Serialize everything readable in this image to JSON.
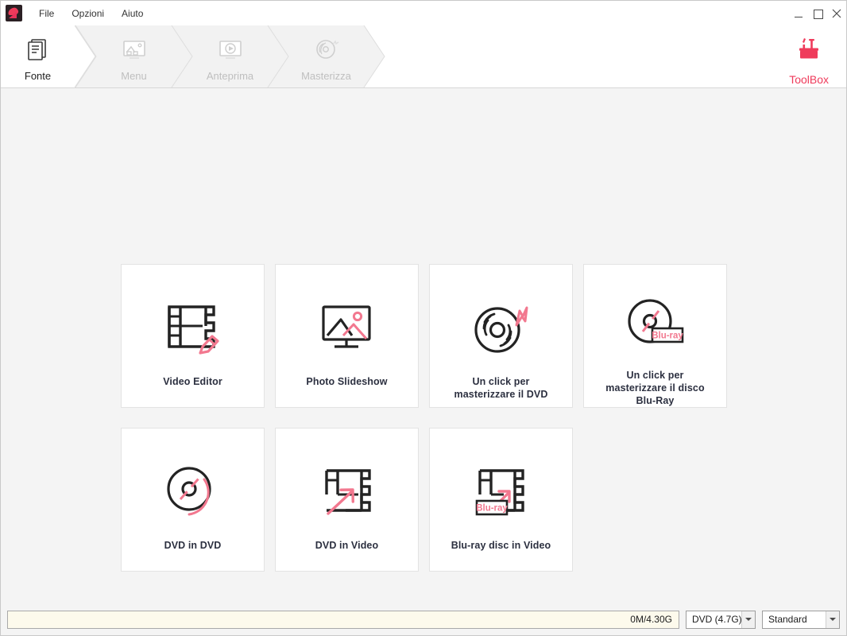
{
  "window": {
    "logo_icon": "app-logo",
    "controls": [
      {
        "name": "minimize",
        "glyph": "minimize-icon"
      },
      {
        "name": "maximize",
        "glyph": "maximize-icon"
      },
      {
        "name": "close",
        "glyph": "close-icon"
      }
    ]
  },
  "menubar": {
    "items": [
      {
        "label": "File"
      },
      {
        "label": "Opzioni"
      },
      {
        "label": "Aiuto"
      }
    ]
  },
  "nav": {
    "steps": [
      {
        "label": "Fonte",
        "icon": "document-stack-icon",
        "active": true
      },
      {
        "label": "Menu",
        "icon": "picture-monitor-icon",
        "active": false
      },
      {
        "label": "Anteprima",
        "icon": "play-monitor-icon",
        "active": false
      },
      {
        "label": "Masterizza",
        "icon": "burn-disc-icon",
        "active": false
      }
    ],
    "toolbox": {
      "label": "ToolBox",
      "icon": "toolbox-icon"
    }
  },
  "main": {
    "cards": [
      {
        "label": "Video Editor",
        "icon": "film-strip-pencil-icon"
      },
      {
        "label": "Photo Slideshow",
        "icon": "monitor-picture-icon"
      },
      {
        "label": "Un click per\nmasterizzare il DVD",
        "icon": "disc-lightning-icon"
      },
      {
        "label": "Un click per\nmasterizzare il disco\nBlu-Ray",
        "icon": "bluray-disc-icon"
      },
      {
        "label": "DVD in DVD",
        "icon": "disc-copy-icon"
      },
      {
        "label": "DVD in Video",
        "icon": "film-strip-arrow-icon"
      },
      {
        "label": "Blu-ray disc in Video",
        "icon": "film-strip-bluray-arrow-icon"
      }
    ]
  },
  "statusbar": {
    "progress_text": "0M/4.30G",
    "progress_percent": 0,
    "disc_select": {
      "value": "DVD (4.7G)"
    },
    "quality_select": {
      "value": "Standard"
    }
  },
  "colors": {
    "accent": "#ef3b5b",
    "accent_soft": "#f2788f",
    "ink": "#232323",
    "label": "#2c3040",
    "bg": "#f4f4f4",
    "progress_bg": "#fdfaec"
  }
}
